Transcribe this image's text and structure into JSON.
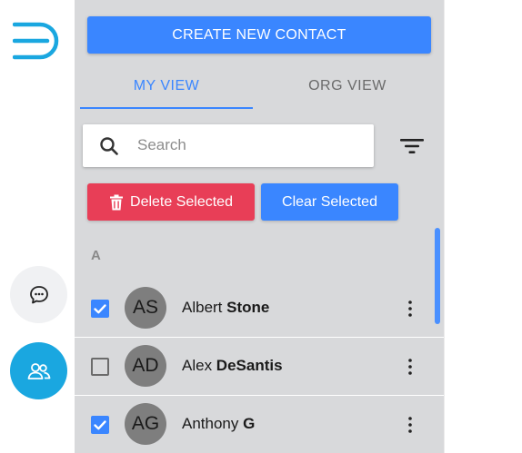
{
  "app": {
    "rail": {
      "logo_icon": "brand-logo-icon",
      "chat_icon": "chat-bubble-icon",
      "contacts_icon": "contacts-icon",
      "active_color": "#1aa7e0"
    }
  },
  "toolbar": {
    "create_label": "CREATE NEW CONTACT"
  },
  "tabs": [
    {
      "label": "MY VIEW",
      "active": true
    },
    {
      "label": "ORG VIEW",
      "active": false
    }
  ],
  "search": {
    "placeholder": "Search",
    "value": ""
  },
  "actions": {
    "delete_label": "Delete Selected",
    "clear_label": "Clear Selected"
  },
  "contacts": {
    "section": "A",
    "items": [
      {
        "initials": "AS",
        "first": "Albert ",
        "last": "Stone",
        "checked": true
      },
      {
        "initials": "AD",
        "first": "Alex ",
        "last": "DeSantis",
        "checked": false
      },
      {
        "initials": "AG",
        "first": "Anthony ",
        "last": "G",
        "checked": true
      }
    ]
  },
  "colors": {
    "primary": "#3a86ff",
    "danger": "#e83e57",
    "panel": "#d8d9db"
  }
}
